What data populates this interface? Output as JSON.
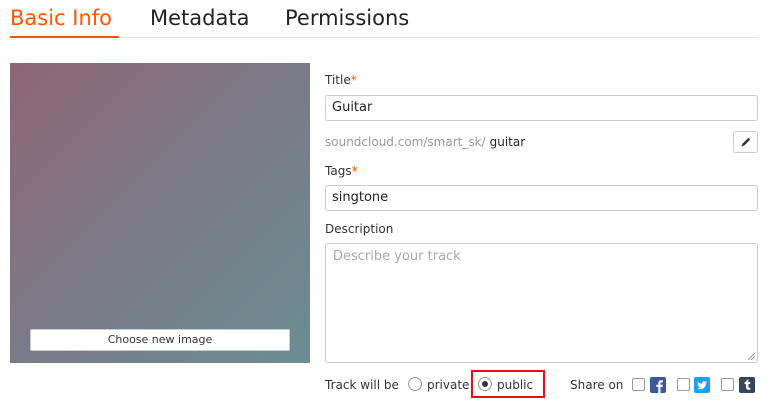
{
  "tabs": [
    {
      "label": "Basic Info",
      "active": true
    },
    {
      "label": "Metadata",
      "active": false
    },
    {
      "label": "Permissions",
      "active": false
    }
  ],
  "artwork": {
    "choose_label": "Choose new image"
  },
  "form": {
    "title_label": "Title",
    "title_value": "Guitar",
    "required_mark": "*",
    "url_base": "soundcloud.com/smart_sk/",
    "url_slug": "guitar",
    "tags_label": "Tags",
    "tags_value": "singtone",
    "description_label": "Description",
    "description_placeholder": "Describe your track"
  },
  "visibility": {
    "label": "Track will be",
    "options": [
      "private",
      "public"
    ],
    "selected": "public"
  },
  "share": {
    "label": "Share on",
    "networks": [
      "facebook-icon",
      "twitter-icon",
      "tumblr-icon"
    ]
  },
  "colors": {
    "accent": "#ff5500",
    "highlight": "#e0101a",
    "facebook": "#3b5998",
    "twitter": "#1da1f2",
    "tumblr": "#35465c"
  }
}
